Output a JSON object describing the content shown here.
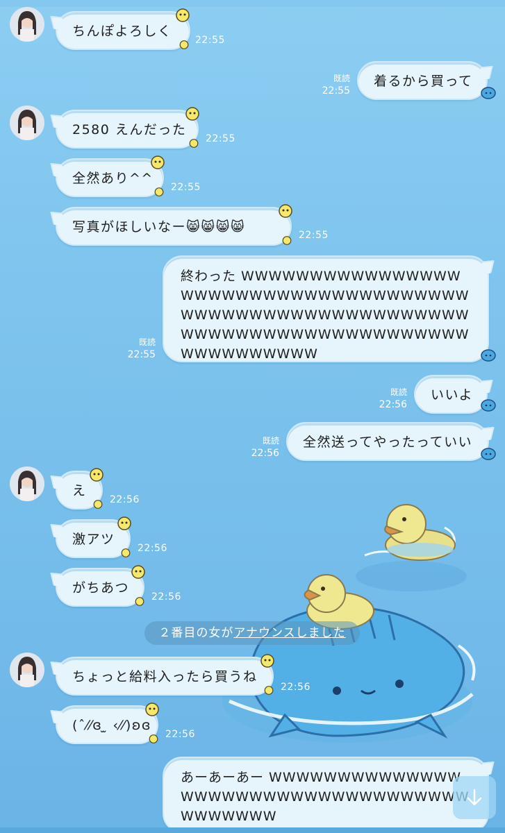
{
  "messages": [
    {
      "side": "in",
      "text": "ちんぽよろしく",
      "time": "22:55"
    },
    {
      "side": "out",
      "text": "着るから買って",
      "read": "既読",
      "time": "22:55"
    },
    {
      "side": "in",
      "text": "2580 えんだった",
      "time": "22:55"
    },
    {
      "side": "in",
      "text": "全然あり^^",
      "time": "22:55"
    },
    {
      "side": "in",
      "text": "写真がほしいなー😸😸😸😸",
      "time": "22:55"
    },
    {
      "side": "out",
      "text": "終わった WWWWWWWWWWWWWWWWWWWWWWWWWWWWWWWWWWWWWWWWWWWWWWWWWWWWWWWWWWWWWWWWWWWWWWWWWWWWWWWWWWWWWWWWW",
      "read": "既読",
      "time": "22:55"
    },
    {
      "side": "out",
      "text": "いいよ",
      "read": "既読",
      "time": "22:56"
    },
    {
      "side": "out",
      "text": "全然送ってやったっていい",
      "read": "既読",
      "time": "22:56"
    },
    {
      "side": "in",
      "text": "え",
      "time": "22:56"
    },
    {
      "side": "in",
      "text": "激アツ",
      "time": "22:56"
    },
    {
      "side": "in",
      "text": "がちあつ",
      "time": "22:56"
    },
    {
      "side": "in",
      "text": "ちょっと給料入ったら買うね",
      "time": "22:56"
    },
    {
      "side": "in",
      "text": "(ˆ⁄⁄ɞ ̫ ‹⁄⁄)ʚɞ",
      "time": "22:56"
    },
    {
      "side": "out",
      "text": "あーあーあー WWWWWWWWWWWWWWWWWWWWWWWWWWWWWWWWWWWWWWWWWW",
      "read": "",
      "time": ""
    }
  ],
  "announcement": {
    "prefix": "２番目の女が",
    "link": "アナウンスしました"
  },
  "icons": {
    "scroll": "arrow-down-icon",
    "chick": "chick-icon",
    "sender_icon": "blue-fish-icon"
  },
  "colors": {
    "bubble": "#e6f4fb",
    "background": "#7ec4ee",
    "time_text": "#ffffff"
  }
}
